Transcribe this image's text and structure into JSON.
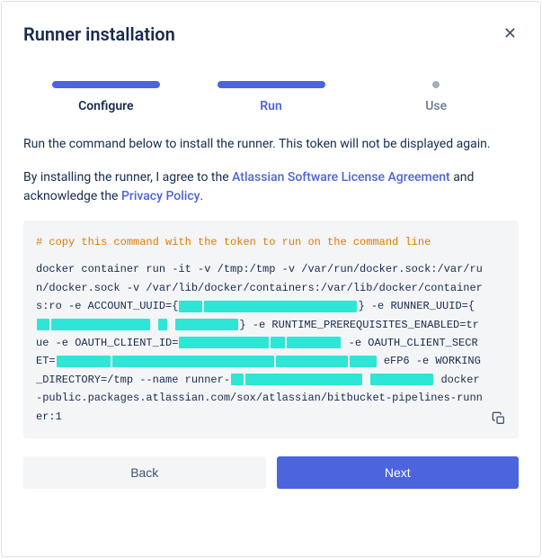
{
  "header": {
    "title": "Runner installation"
  },
  "stepper": {
    "steps": [
      {
        "label": "Configure"
      },
      {
        "label": "Run"
      },
      {
        "label": "Use"
      }
    ]
  },
  "body": {
    "instruction": "Run the command below to install the runner. This token will not be displayed again.",
    "agree_prefix": "By installing the runner, I agree to the ",
    "license_link": "Atlassian Software License Agreement",
    "agree_mid": " and acknowledge the ",
    "privacy_link": "Privacy Policy",
    "agree_suffix": "."
  },
  "code": {
    "comment": "# copy this command with the token to run on the command line",
    "seg1": "docker container run -it -v /tmp:/tmp -v /var/run/docker.sock:/var/run/docker.sock -v /var/lib/docker/containers:/var/lib/docker/containers:ro -e ACCOUNT_UUID={",
    "seg2": "}  -e RUNNER_UUID={",
    "seg3": "} -e RUNTIME_PREREQUISITES_ENABLED=true -e OAUTH_CLIENT_ID=",
    "seg4": " -e OAUTH_CLIENT_SECRET=",
    "seg5": "eFP6 -e WORKING_DIRECTORY=/tmp --name runner-",
    "seg6": " docker-public.packages.atlassian.com/sox/atlassian/bitbucket-pipelines-runner:1"
  },
  "footer": {
    "back": "Back",
    "next": "Next"
  }
}
